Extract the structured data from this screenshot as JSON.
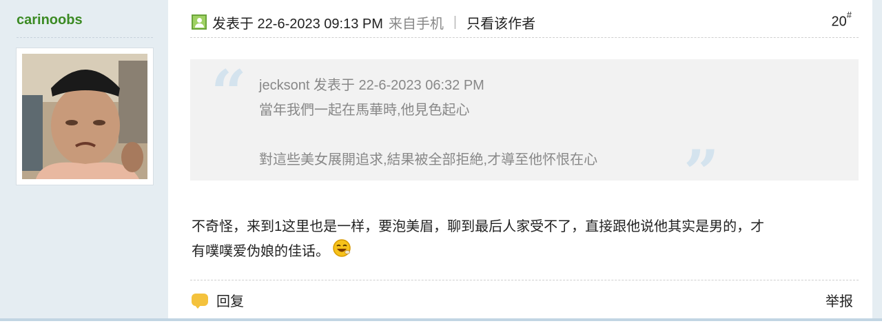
{
  "post": {
    "author": "carinoobs",
    "header": {
      "posted_label": "发表于 22-6-2023 09:13 PM",
      "from_label": "来自手机",
      "separator": "|",
      "only_author_label": "只看该作者"
    },
    "floor": {
      "number": "20",
      "suffix": "#"
    },
    "quote": {
      "open_mark": "“",
      "close_mark": "”",
      "lines": [
        "jecksont 发表于 22-6-2023 06:32 PM",
        "當年我們一起在馬華時,他見色起心",
        "",
        "對這些美女展開追求,結果被全部拒絶,才導至他怀恨在心"
      ]
    },
    "content": {
      "line1": "不奇怪，来到1这里也是一样，要泡美眉，聊到最后人家受不了，直接跟他说他其实是男的，才",
      "line2": "有噗噗爱伪娘的佳话。"
    },
    "footer": {
      "reply_label": "回复",
      "report_label": "举报"
    }
  },
  "icons": {
    "online": "online-user-icon",
    "reply": "speech-bubble-icon",
    "emoji": "laughing-face-icon"
  },
  "colors": {
    "author_name": "#3b8a23",
    "sidebar_bg": "#e5edf2",
    "quote_bg": "#f2f2f2",
    "quote_mark": "#d4e3ee"
  }
}
